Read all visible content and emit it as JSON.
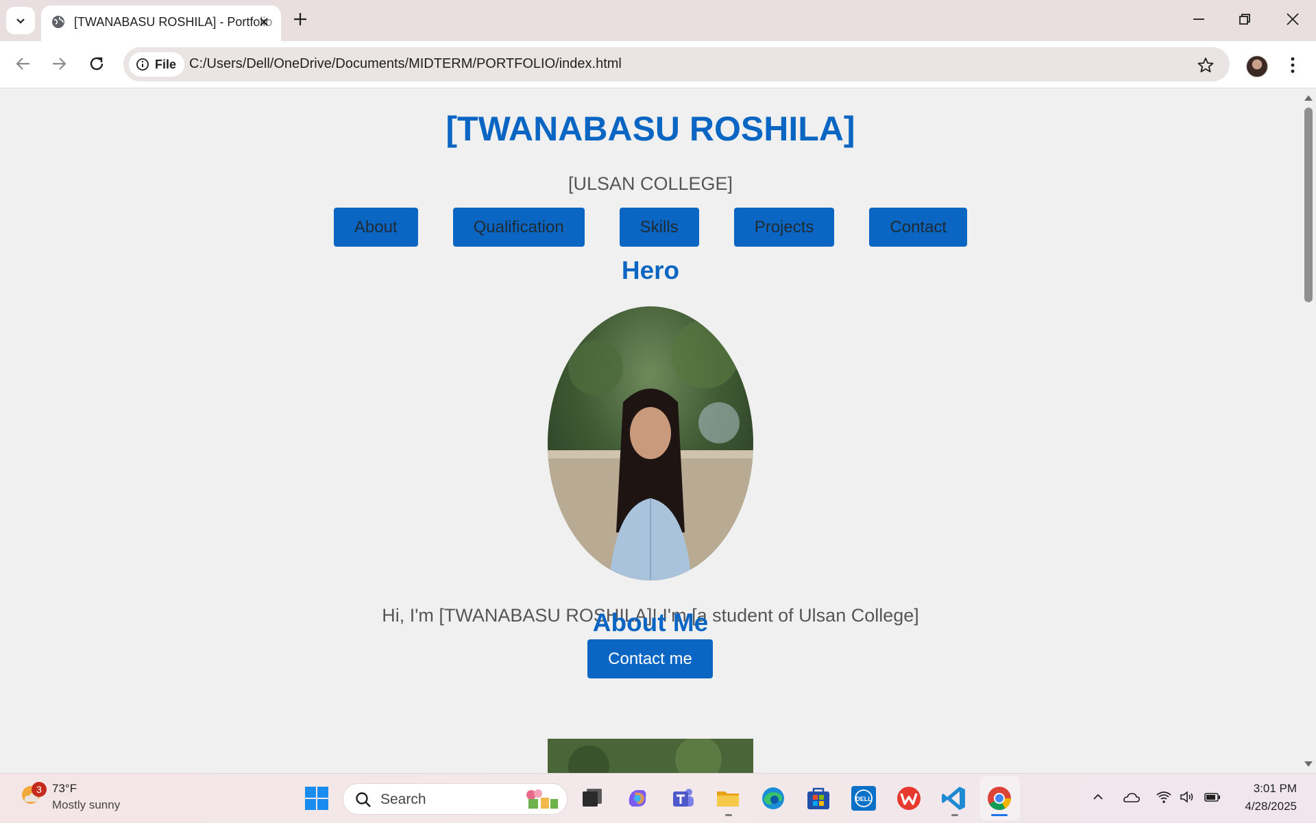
{
  "browser": {
    "tab_title": "[TWANABASU ROSHILA] - Portfolio",
    "site_chip_label": "File",
    "url": "C:/Users/Dell/OneDrive/Documents/MIDTERM/PORTFOLIO/index.html"
  },
  "page": {
    "name": "[TWANABASU ROSHILA]",
    "subtitle": "[ULSAN COLLEGE]",
    "nav": [
      "About",
      "Qualification",
      "Skills",
      "Projects",
      "Contact"
    ],
    "hero_heading": "Hero",
    "intro": "Hi, I'm [TWANABASU ROSHILA]! I'm [a student of Ulsan College]",
    "cta_label": "Contact me",
    "about_heading": "About Me",
    "accent_color": "#0a66c2"
  },
  "taskbar": {
    "weather_badge": "3",
    "temperature": "73°F",
    "condition": "Mostly sunny",
    "search_placeholder": "Search",
    "time": "3:01 PM",
    "date": "4/28/2025"
  }
}
